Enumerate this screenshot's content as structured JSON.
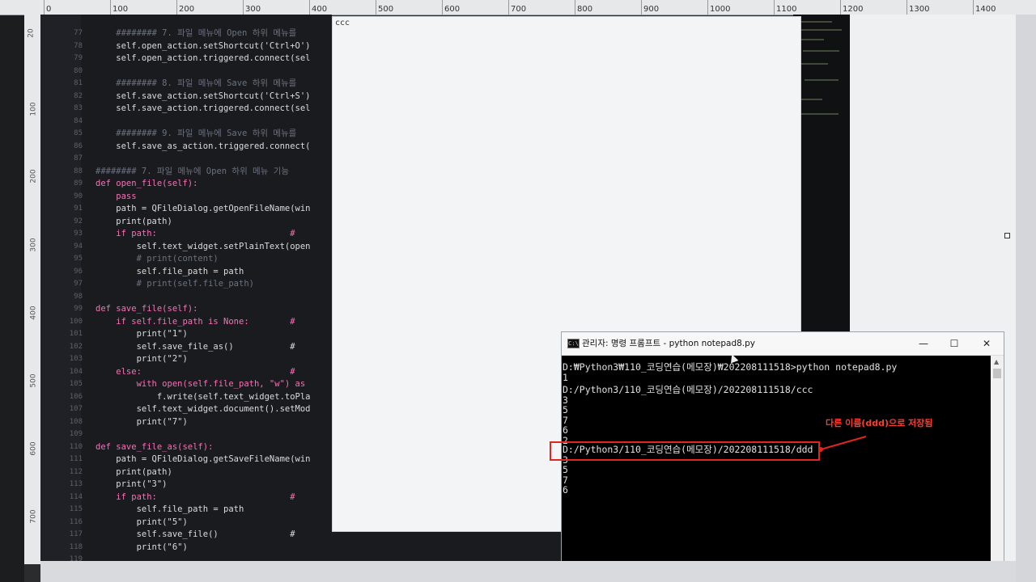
{
  "ruler": {
    "ticks": [
      "0",
      "100",
      "200",
      "300",
      "400",
      "500",
      "600",
      "700",
      "800",
      "900",
      "1000",
      "1100",
      "1200",
      "1300",
      "1400"
    ]
  },
  "editor": {
    "lines": [
      {
        "n": "77",
        "code": "    ######## 7. 파일 메뉴에 Open 하위 메뉴를"
      },
      {
        "n": "78",
        "code": "    self.open_action.setShortcut('Ctrl+O')"
      },
      {
        "n": "79",
        "code": "    self.open_action.triggered.connect(sel"
      },
      {
        "n": "80",
        "code": ""
      },
      {
        "n": "81",
        "code": "    ######## 8. 파일 메뉴에 Save 하위 메뉴를"
      },
      {
        "n": "82",
        "code": "    self.save_action.setShortcut('Ctrl+S')"
      },
      {
        "n": "83",
        "code": "    self.save_action.triggered.connect(sel"
      },
      {
        "n": "84",
        "code": ""
      },
      {
        "n": "85",
        "code": "    ######## 9. 파일 메뉴에 Save 하위 메뉴를"
      },
      {
        "n": "86",
        "code": "    self.save_as_action.triggered.connect("
      },
      {
        "n": "87",
        "code": ""
      },
      {
        "n": "88",
        "code": "######## 7. 파일 메뉴에 Open 하위 메뉴 기능"
      },
      {
        "n": "89",
        "code": "def open_file(self):"
      },
      {
        "n": "90",
        "code": "    pass"
      },
      {
        "n": "91",
        "code": "    path = QFileDialog.getOpenFileName(win"
      },
      {
        "n": "92",
        "code": "    print(path)"
      },
      {
        "n": "93",
        "code": "    if path:                          #"
      },
      {
        "n": "94",
        "code": "        self.text_widget.setPlainText(open"
      },
      {
        "n": "95",
        "code": "        # print(content)"
      },
      {
        "n": "96",
        "code": "        self.file_path = path"
      },
      {
        "n": "97",
        "code": "        # print(self.file_path)"
      },
      {
        "n": "98",
        "code": ""
      },
      {
        "n": "99",
        "code": "def save_file(self):"
      },
      {
        "n": "100",
        "code": "    if self.file_path is None:        #"
      },
      {
        "n": "101",
        "code": "        print(\"1\")"
      },
      {
        "n": "102",
        "code": "        self.save_file_as()           #"
      },
      {
        "n": "103",
        "code": "        print(\"2\")"
      },
      {
        "n": "104",
        "code": "    else:                             #"
      },
      {
        "n": "105",
        "code": "        with open(self.file_path, \"w\") as"
      },
      {
        "n": "106",
        "code": "            f.write(self.text_widget.toPla"
      },
      {
        "n": "107",
        "code": "        self.text_widget.document().setMod"
      },
      {
        "n": "108",
        "code": "        print(\"7\")"
      },
      {
        "n": "109",
        "code": ""
      },
      {
        "n": "110",
        "code": "def save_file_as(self):"
      },
      {
        "n": "111",
        "code": "    path = QFileDialog.getSaveFileName(win"
      },
      {
        "n": "112",
        "code": "    print(path)"
      },
      {
        "n": "113",
        "code": "    print(\"3\")"
      },
      {
        "n": "114",
        "code": "    if path:                          #"
      },
      {
        "n": "115",
        "code": "        self.file_path = path"
      },
      {
        "n": "116",
        "code": "        print(\"5\")"
      },
      {
        "n": "117",
        "code": "        self.save_file()              #"
      },
      {
        "n": "118",
        "code": "        print(\"6\")"
      },
      {
        "n": "119",
        "code": ""
      }
    ]
  },
  "notepad": {
    "text": "ccc"
  },
  "cmd": {
    "title": "관리자: 명령 프롬프트 - python  notepad8.py",
    "icon_text": "C:\\",
    "minimize": "—",
    "maximize": "☐",
    "close": "✕",
    "lines": [
      "D:₩Python3₩110_코딩연습(메모장)₩202208111518>python notepad8.py",
      "1",
      "D:/Python3/110_코딩연습(메모장)/202208111518/ccc",
      "3",
      "5",
      "7",
      "6",
      "2",
      "D:/Python3/110_코딩연습(메모장)/202208111518/ddd",
      "3",
      "5",
      "7",
      "6"
    ]
  },
  "annotation": {
    "text": "다른 이름(ddd)으로 저장됨",
    "color": "#e0261e"
  }
}
